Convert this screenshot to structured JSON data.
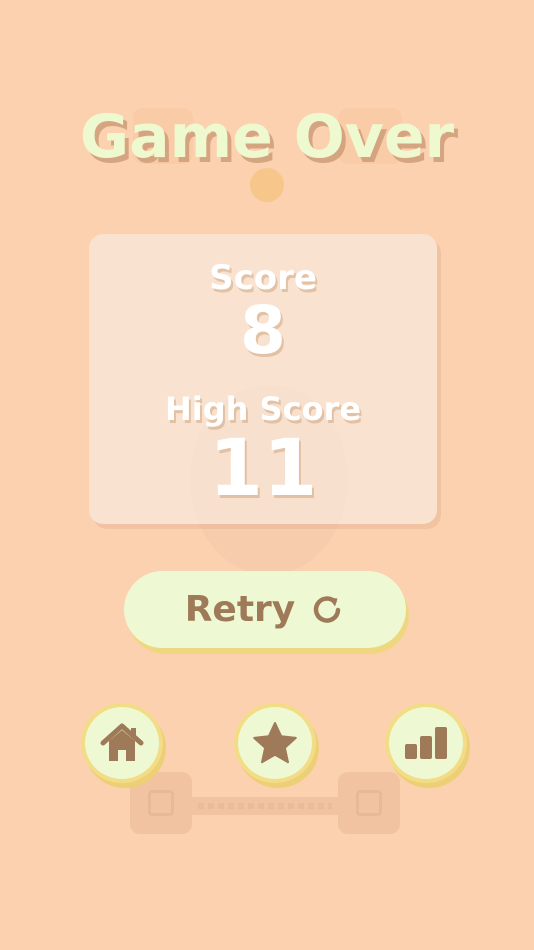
{
  "title": "Game Over",
  "score": {
    "label": "Score",
    "value": "8"
  },
  "high_score": {
    "label": "High Score",
    "value": "11"
  },
  "retry": {
    "label": "Retry",
    "icon": "restart-icon"
  },
  "bottom_buttons": [
    {
      "name": "home-button",
      "icon": "home-icon"
    },
    {
      "name": "star-button",
      "icon": "star-icon"
    },
    {
      "name": "stats-button",
      "icon": "bar-chart-icon"
    }
  ],
  "colors": {
    "background": "#fcd1b0",
    "title": "#eef9cf",
    "button_fill": "#eef9d4",
    "button_shadow": "#efd77f",
    "icon": "#9e7a58",
    "score_text": "#ffffff"
  }
}
